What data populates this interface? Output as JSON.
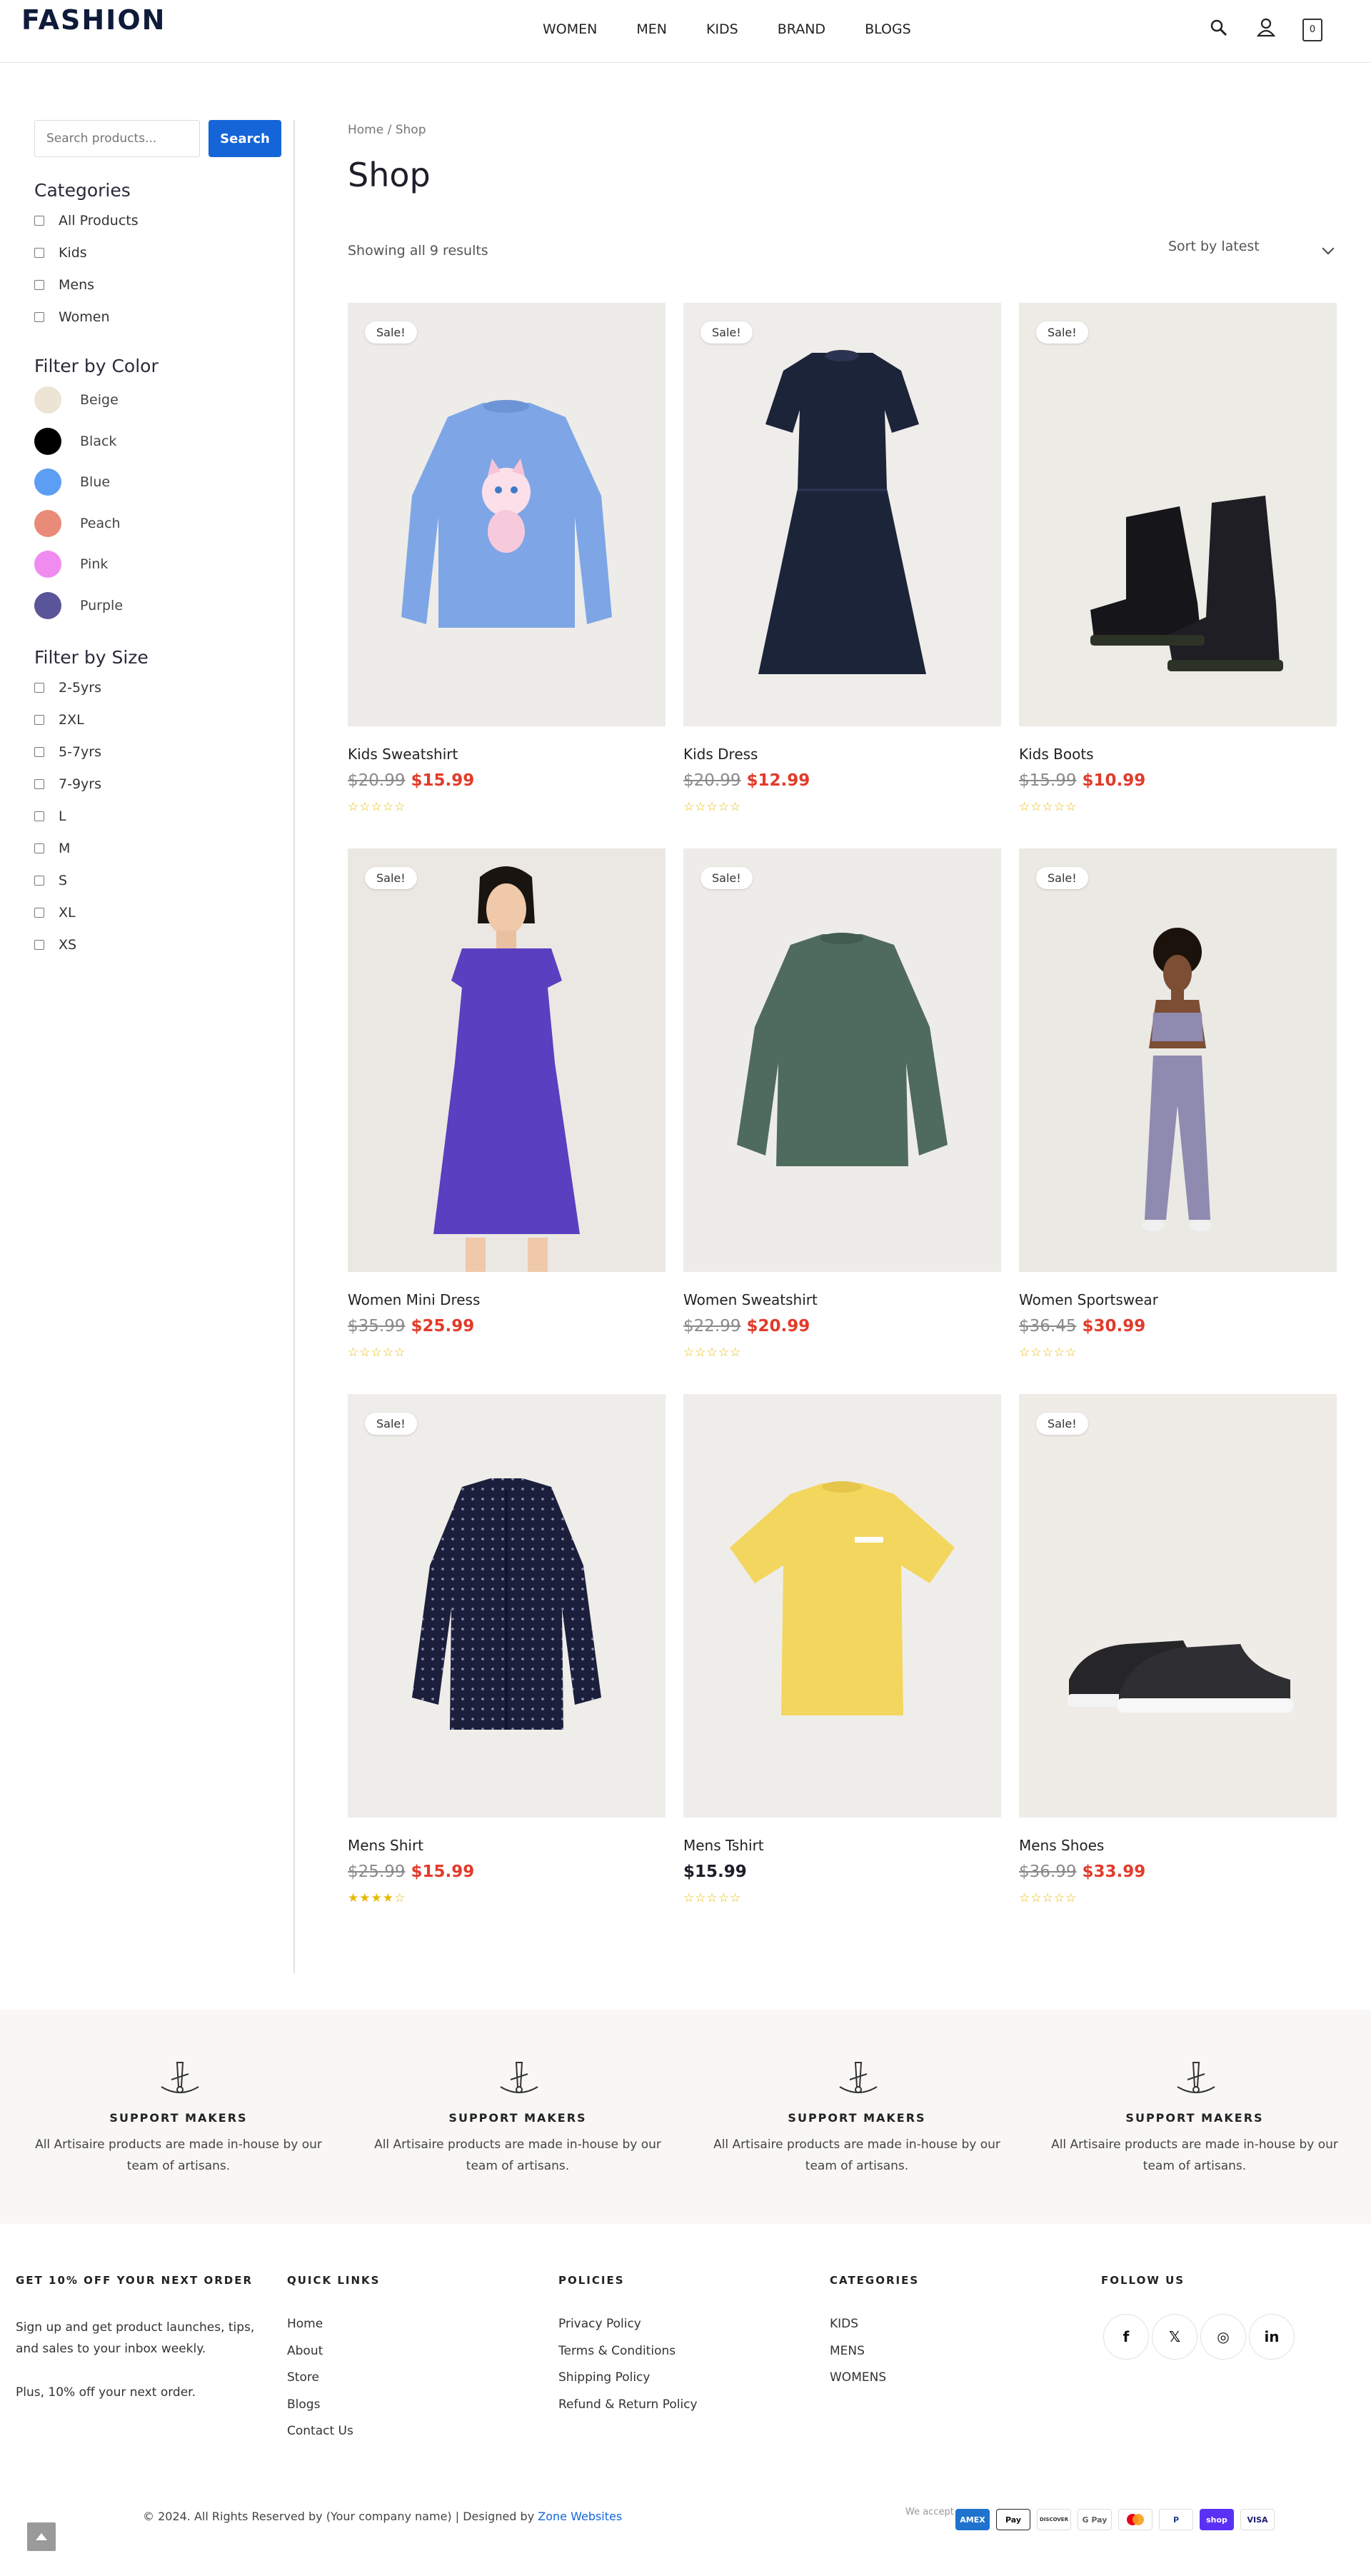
{
  "brand": {
    "logo": "FASHION"
  },
  "nav": {
    "items": [
      "WOMEN",
      "MEN",
      "KIDS",
      "BRAND",
      "BLOGS"
    ]
  },
  "header": {
    "cart_count": "0",
    "icons": [
      "search-icon",
      "user-icon",
      "cart-icon"
    ]
  },
  "search": {
    "placeholder": "Search products...",
    "button": "Search"
  },
  "categories": {
    "title": "Categories",
    "items": [
      "All Products",
      "Kids",
      "Mens",
      "Women"
    ]
  },
  "colors": {
    "title": "Filter by Color",
    "items": [
      {
        "label": "Beige",
        "hex": "#ece4d4"
      },
      {
        "label": "Black",
        "hex": "#000000"
      },
      {
        "label": "Blue",
        "hex": "#5c9ef3"
      },
      {
        "label": "Peach",
        "hex": "#e98b78"
      },
      {
        "label": "Pink",
        "hex": "#f08cf0"
      },
      {
        "label": "Purple",
        "hex": "#5a5499"
      }
    ]
  },
  "sizes": {
    "title": "Filter by Size",
    "items": [
      "2-5yrs",
      "2XL",
      "5-7yrs",
      "7-9yrs",
      "L",
      "M",
      "S",
      "XL",
      "XS"
    ]
  },
  "main": {
    "breadcrumb": "Home / Shop",
    "title": "Shop",
    "result_count": "Showing all 9 results",
    "sort": "Sort by latest"
  },
  "products": [
    {
      "name": "Kids Sweatshirt",
      "old_price": "$20.99",
      "price": "$15.99",
      "sale": "Sale!",
      "rating": 0,
      "bg": "#eeece8"
    },
    {
      "name": "Kids Dress",
      "old_price": "$20.99",
      "price": "$12.99",
      "sale": "Sale!",
      "rating": 0,
      "bg": "#efede9"
    },
    {
      "name": "Kids Boots",
      "old_price": "$15.99",
      "price": "$10.99",
      "sale": "Sale!",
      "rating": 0,
      "bg": "#edebe6"
    },
    {
      "name": "Women Mini Dress",
      "old_price": "$35.99",
      "price": "$25.99",
      "sale": "Sale!",
      "rating": 0,
      "bg": "#ebe8e3"
    },
    {
      "name": "Women Sweatshirt",
      "old_price": "$22.99",
      "price": "$20.99",
      "sale": "Sale!",
      "rating": 0,
      "bg": "#eeece8"
    },
    {
      "name": "Women Sportswear",
      "old_price": "$36.45",
      "price": "$30.99",
      "sale": "Sale!",
      "rating": 0,
      "bg": "#ebe9e4"
    },
    {
      "name": "Mens Shirt",
      "old_price": "$25.99",
      "price": "$15.99",
      "sale": "Sale!",
      "rating": 4,
      "bg": "#efede9"
    },
    {
      "name": "Mens Tshirt",
      "old_price": "",
      "price": "$15.99",
      "sale": "",
      "rating": 0,
      "bg": "#efedea"
    },
    {
      "name": "Mens Shoes",
      "old_price": "$36.99",
      "price": "$33.99",
      "sale": "Sale!",
      "rating": 0,
      "bg": "#efece7"
    }
  ],
  "features": [
    {
      "title": "SUPPORT MAKERS",
      "text": "All Artisaire products are made in-house by our team of artisans."
    },
    {
      "title": "SUPPORT MAKERS",
      "text": "All Artisaire products are made in-house by our team of artisans."
    },
    {
      "title": "SUPPORT MAKERS",
      "text": "All Artisaire products are made in-house by our team of artisans."
    },
    {
      "title": "SUPPORT MAKERS",
      "text": "All Artisaire products are made in-house by our team of artisans."
    }
  ],
  "footer": {
    "newsletter": {
      "title": "GET 10% OFF YOUR NEXT ORDER",
      "text1": "Sign up and get product launches, tips, and sales to your inbox weekly.",
      "text2": "Plus, 10% off your next order."
    },
    "quick_links": {
      "title": "QUICK LINKS",
      "items": [
        "Home",
        "About",
        "Store",
        "Blogs",
        "Contact Us"
      ]
    },
    "policies": {
      "title": "POLICIES",
      "items": [
        "Privacy Policy",
        "Terms & Conditions",
        "Shipping Policy",
        "Refund & Return Policy"
      ]
    },
    "categories": {
      "title": "CATEGORIES",
      "items": [
        "KIDS",
        "MENS",
        "WOMENS"
      ]
    },
    "follow": {
      "title": "FOLLOW US",
      "icons": [
        "facebook-icon",
        "x-icon",
        "instagram-icon",
        "linkedin-icon"
      ],
      "glyphs": [
        "f",
        "𝕏",
        "◎",
        "in"
      ]
    },
    "copyright": "© 2024. All Rights Reserved by (Your company name) | Designed by",
    "credit": "Zone Websites",
    "we_accept": "We accept",
    "payments": [
      "AMEX",
      "Pay",
      "DISCOVER",
      "G Pay",
      "",
      "P",
      "shop",
      "VISA"
    ]
  }
}
